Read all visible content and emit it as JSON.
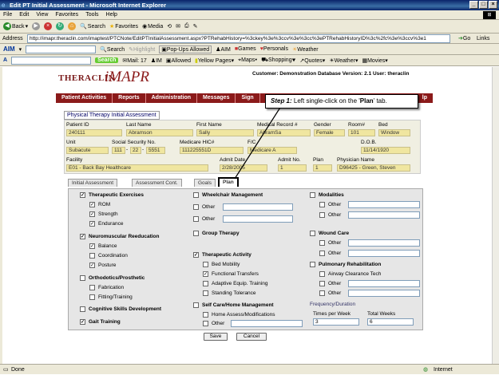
{
  "window": {
    "title": "Edit PT Initial Assessment - Microsoft Internet Explorer"
  },
  "menu": [
    "File",
    "Edit",
    "View",
    "Favorites",
    "Tools",
    "Help"
  ],
  "toolbar": {
    "back": "Back",
    "search": "Search",
    "favorites": "Favorites",
    "media": "Media"
  },
  "address": {
    "label": "Address",
    "url": "http://imapr.theraclin.com/imaptest/PTCNote/EditPTInitialAssessment.aspx?PTRehabHistory=%3ckey%3e%3ccv%3e%3cc%3ePTRehabHistoryID%3c%2fc%3e%3ccv%3e1",
    "go": "Go",
    "links": "Links"
  },
  "aimbar": {
    "logo": "AIM",
    "search": "Search",
    "highlight": "Highlight",
    "popups": "Pop-Ups Allowed",
    "aim": "AIM",
    "games": "Games",
    "personals": "Personals",
    "weather": "Weather"
  },
  "linksbar": {
    "search": "Search",
    "mail": "Mail: 17",
    "im": "IM",
    "allowed": "Allowed",
    "yellow": "Yellow Pages",
    "maps": "Maps",
    "shopping": "Shopping",
    "quotes": "Quotes",
    "weather": "Weather",
    "movies": "Movies"
  },
  "app": {
    "logo1": "THERACLIN",
    "logo2": "iMAPR",
    "customer": "Customer: Demonstration Database Version: 2.1 User: theraclin"
  },
  "nav": [
    "Patient Activities",
    "Reports",
    "Administration",
    "Messages",
    "Sign",
    "lp"
  ],
  "callout": {
    "step": "Step 1:",
    "pre": " Left single-click on the '",
    "tab": "Plan",
    "post": "' tab."
  },
  "form": {
    "title": "Physical Therapy Initial Assessment",
    "labels": {
      "patient_id": "Patient ID",
      "last_name": "Last Name",
      "first_name": "First Name",
      "medical_record": "Medical Record #",
      "gender": "Gender",
      "room": "Room#",
      "bed": "Bed",
      "unit": "Unit",
      "ssn": "Social Security No.",
      "medicare": "Medicare HIC#",
      "fc": "F/C",
      "dob": "D.O.B.",
      "facility": "Facility",
      "admit_date": "Admit Date",
      "admit_no": "Admit No.",
      "plan": "Plan",
      "physician": "Physician Name"
    },
    "values": {
      "patient_id": "240111",
      "last_name": "Abramson",
      "first_name": "Sally",
      "medical_record": "AbramSa",
      "gender": "Female",
      "room": "101",
      "bed": "Window",
      "unit": "Subacute",
      "ssn1": "111",
      "ssn2": "22",
      "ssn3": "5551",
      "medicare": "111225551D",
      "fc": "Medicare A",
      "dob": "11/14/1920",
      "facility": "E01 - Back Bay Healthcare",
      "admit_date": "2/28/2005",
      "admit_no": "1",
      "plan": "1",
      "physician": "D96425 - Green, Steven"
    }
  },
  "tabs": [
    "Initial Assessment",
    "Assessment Cont.",
    "Goals",
    "Plan"
  ],
  "plan": {
    "col1": [
      {
        "label": "Therapeutic Exercises",
        "checked": true,
        "bold": true
      },
      {
        "label": "ROM",
        "checked": true,
        "sub": true
      },
      {
        "label": "Strength",
        "checked": true,
        "sub": true
      },
      {
        "label": "Endurance",
        "checked": true,
        "sub": true
      },
      {
        "label": "Neuromuscular Reeducation",
        "checked": true,
        "bold": true
      },
      {
        "label": "Balance",
        "checked": true,
        "sub": true
      },
      {
        "label": "Coordination",
        "checked": false,
        "sub": true
      },
      {
        "label": "Posture",
        "checked": true,
        "sub": true
      },
      {
        "label": "Orthodotics/Prosthetic",
        "checked": false,
        "bold": true
      },
      {
        "label": "Fabrication",
        "checked": false,
        "sub": true
      },
      {
        "label": "Fitting/Training",
        "checked": false,
        "sub": true
      },
      {
        "label": "Cognitive Skills Development",
        "checked": false,
        "bold": true
      },
      {
        "label": "Gait Training",
        "checked": true,
        "bold": true
      }
    ],
    "col2": {
      "wheelchair": "Wheelchair Management",
      "other": "Other",
      "group": "Group Therapy",
      "therapeutic": "Therapeutic Activity",
      "bed": "Bed Mobility",
      "functional": "Functional Transfers",
      "adaptive": "Adaptive Equip. Training",
      "standing": "Standing Tolerance",
      "selfcare": "Self Care/Home Management",
      "homeassess": "Home Assess/Modifications"
    },
    "col3": {
      "modalities": "Modalities",
      "other": "Other",
      "wound": "Wound Care",
      "pulmonary": "Pulmonary Rehabilitation",
      "airway": "Airway Clearance Tech"
    },
    "freq": {
      "title": "Frequency/Duration",
      "times": "Times per Week",
      "total": "Total Weeks",
      "times_val": "3",
      "total_val": "6"
    },
    "save": "Save",
    "cancel": "Cancel"
  },
  "status": {
    "done": "Done",
    "zone": "Internet"
  }
}
